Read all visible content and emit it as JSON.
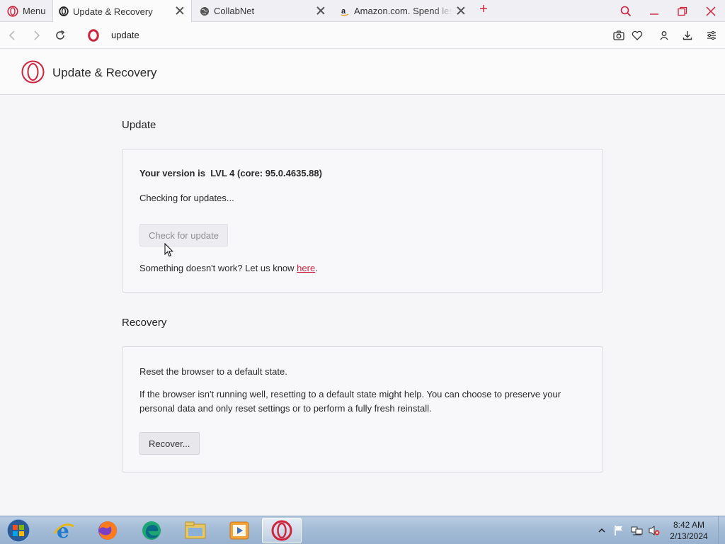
{
  "browser": {
    "menu_label": "Menu",
    "tabs": [
      {
        "title": "Update & Recovery",
        "active": true
      },
      {
        "title": "CollabNet",
        "active": false
      },
      {
        "title": "Amazon.com. Spend less. Smile more.",
        "active": false
      }
    ],
    "address": "update",
    "accent_color": "#d0233c"
  },
  "page": {
    "header_title": "Update & Recovery",
    "update": {
      "section_title": "Update",
      "version_label": "Your version is",
      "version_value": "LVL 4 (core: 95.0.4635.88)",
      "status": "Checking for updates...",
      "check_button": "Check for update",
      "feedback_text": "Something doesn't work? Let us know ",
      "feedback_link": "here",
      "feedback_end": "."
    },
    "recovery": {
      "section_title": "Recovery",
      "intro": "Reset the browser to a default state.",
      "description_line1": "If the browser isn't running well, resetting to a default state might help. You can choose to preserve your",
      "description_line2": "personal data and only reset settings or to perform a fully fresh reinstall.",
      "recover_button": "Recover..."
    }
  },
  "taskbar": {
    "apps": [
      "internet-explorer",
      "firefox",
      "edge-chromium",
      "file-explorer",
      "media-player",
      "opera"
    ],
    "clock_time": "8:42 AM",
    "clock_date": "2/13/2024"
  }
}
